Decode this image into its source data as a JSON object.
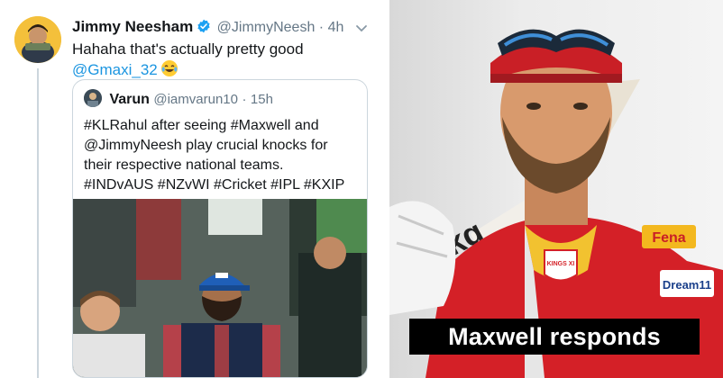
{
  "tweet": {
    "author_name": "Jimmy Neesham",
    "author_handle": "@JimmyNeesh",
    "separator": "·",
    "time": "4h",
    "text": "Hahaha that's actually pretty good",
    "mention": "@Gmaxi_32",
    "emoji": "laughing-tears-emoji",
    "verified_color": "#1da1f2",
    "quoted": {
      "author_name": "Varun",
      "author_handle": "@iamvarun10",
      "separator": "·",
      "time": "15h",
      "text_line1": "#KLRahul after seeing #Maxwell and",
      "text_line2": "@JimmyNeesh play crucial knocks for",
      "text_line3": "their respective national teams.",
      "text_line4": "#INDvAUS #NZvWI #Cricket #IPL #KXIP",
      "photo": "fan-in-blue-cap-and-vest-in-crowd"
    }
  },
  "right_photo": {
    "subject": "cricketer-in-red-kings-xi-jersey-with-bat",
    "jersey_badge": "KINGS XI",
    "sponsor_chest": "Fena",
    "sponsor_sleeve": "Dream11",
    "accent_color": "#d42027"
  },
  "caption": {
    "text": "Maxwell responds"
  }
}
